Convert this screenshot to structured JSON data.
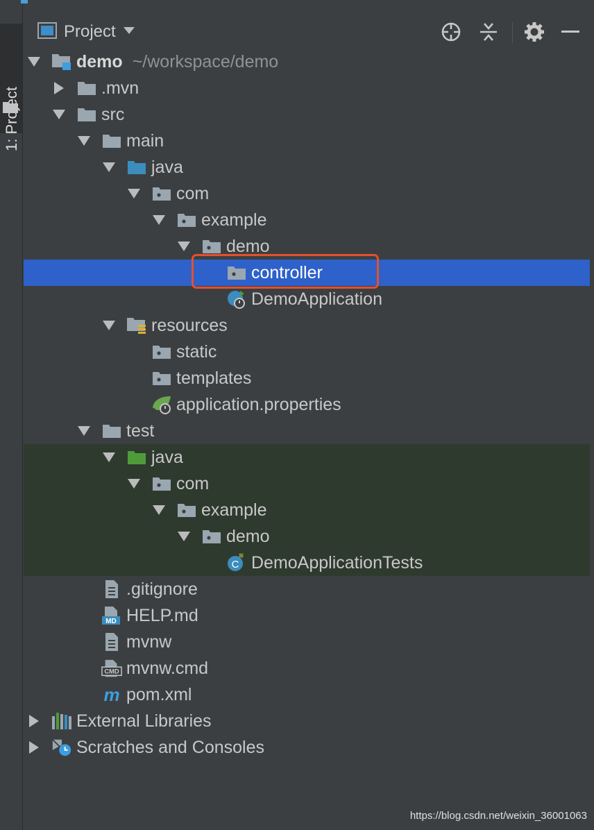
{
  "sidebar": {
    "tab_label": "1: Project"
  },
  "toolbar": {
    "title": "Project"
  },
  "tree": [
    {
      "label": "demo",
      "hint": "~/workspace/demo",
      "bold": true,
      "depth": 0,
      "arrow": "down",
      "icon": "module-folder-icon"
    },
    {
      "label": ".mvn",
      "depth": 1,
      "arrow": "right",
      "icon": "folder-icon"
    },
    {
      "label": "src",
      "depth": 1,
      "arrow": "down",
      "icon": "folder-icon"
    },
    {
      "label": "main",
      "depth": 2,
      "arrow": "down",
      "icon": "folder-icon"
    },
    {
      "label": "java",
      "depth": 3,
      "arrow": "down",
      "icon": "source-folder-icon"
    },
    {
      "label": "com",
      "depth": 4,
      "arrow": "down",
      "icon": "package-icon"
    },
    {
      "label": "example",
      "depth": 5,
      "arrow": "down",
      "icon": "package-icon"
    },
    {
      "label": "demo",
      "depth": 6,
      "arrow": "down",
      "icon": "package-icon"
    },
    {
      "label": "controller",
      "depth": 7,
      "arrow": "none",
      "icon": "package-icon",
      "selected": true
    },
    {
      "label": "DemoApplication",
      "depth": 7,
      "arrow": "none",
      "icon": "spring-boot-class-icon"
    },
    {
      "label": "resources",
      "depth": 3,
      "arrow": "down",
      "icon": "resources-folder-icon"
    },
    {
      "label": "static",
      "depth": 4,
      "arrow": "none",
      "icon": "package-icon"
    },
    {
      "label": "templates",
      "depth": 4,
      "arrow": "none",
      "icon": "package-icon"
    },
    {
      "label": "application.properties",
      "depth": 4,
      "arrow": "none",
      "icon": "spring-properties-icon"
    },
    {
      "label": "test",
      "depth": 2,
      "arrow": "down",
      "icon": "folder-icon"
    },
    {
      "label": "java",
      "depth": 3,
      "arrow": "down",
      "icon": "test-folder-icon",
      "green": true
    },
    {
      "label": "com",
      "depth": 4,
      "arrow": "down",
      "icon": "package-icon",
      "green": true
    },
    {
      "label": "example",
      "depth": 5,
      "arrow": "down",
      "icon": "package-icon",
      "green": true
    },
    {
      "label": "demo",
      "depth": 6,
      "arrow": "down",
      "icon": "package-icon",
      "green": true
    },
    {
      "label": "DemoApplicationTests",
      "depth": 7,
      "arrow": "none",
      "icon": "test-class-icon",
      "green": true
    },
    {
      "label": ".gitignore",
      "depth": 2,
      "arrow": "none",
      "icon": "text-file-icon"
    },
    {
      "label": "HELP.md",
      "depth": 2,
      "arrow": "none",
      "icon": "markdown-file-icon"
    },
    {
      "label": "mvnw",
      "depth": 2,
      "arrow": "none",
      "icon": "text-file-icon"
    },
    {
      "label": "mvnw.cmd",
      "depth": 2,
      "arrow": "none",
      "icon": "cmd-file-icon"
    },
    {
      "label": "pom.xml",
      "depth": 2,
      "arrow": "none",
      "icon": "maven-icon"
    },
    {
      "label": "External Libraries",
      "depth": 0,
      "arrow": "right",
      "icon": "libraries-icon"
    },
    {
      "label": "Scratches and Consoles",
      "depth": 0,
      "arrow": "right",
      "icon": "scratches-icon"
    }
  ],
  "watermark": "https://blog.csdn.net/weixin_36001063",
  "colors": {
    "selection": "#2e61c9",
    "highlight_border": "#e4502f",
    "test_background": "#2f3a2f"
  }
}
